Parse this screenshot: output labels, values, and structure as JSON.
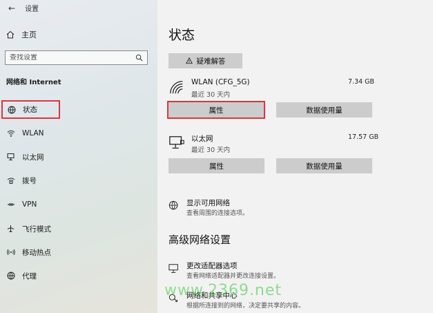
{
  "window": {
    "title": "设置"
  },
  "sidebar": {
    "home": "主页",
    "search_placeholder": "查找设置",
    "section": "网络和 Internet",
    "items": [
      {
        "label": "状态",
        "icon": "globe-icon"
      },
      {
        "label": "WLAN",
        "icon": "wifi-icon"
      },
      {
        "label": "以太网",
        "icon": "ethernet-icon"
      },
      {
        "label": "拨号",
        "icon": "dialup-icon"
      },
      {
        "label": "VPN",
        "icon": "vpn-icon"
      },
      {
        "label": "飞行模式",
        "icon": "airplane-icon"
      },
      {
        "label": "移动热点",
        "icon": "hotspot-icon"
      },
      {
        "label": "代理",
        "icon": "proxy-globe-icon"
      }
    ]
  },
  "main": {
    "title": "状态",
    "troubleshoot": "疑难解答",
    "connections": [
      {
        "name": "WLAN (CFG_5G)",
        "sub": "最近 30 天内",
        "size": "7.34 GB",
        "props": "属性",
        "usage": "数据使用量"
      },
      {
        "name": "以太网",
        "sub": "最近 30 天内",
        "size": "17.57 GB",
        "props": "属性",
        "usage": "数据使用量"
      }
    ],
    "show_networks": {
      "title": "显示可用网络",
      "desc": "查看周围的连接选项。"
    },
    "advanced_title": "高级网络设置",
    "advanced": [
      {
        "title": "更改适配器选项",
        "desc": "查看网络适配器并更改连接设置。"
      },
      {
        "title": "网络和共享中心",
        "desc": "根据所连接到的网络，决定要共享的内容。"
      }
    ]
  },
  "watermark": "www.2369.net",
  "colors": {
    "highlight_frame": "#d9363e",
    "button_gray": "#cccccc"
  }
}
